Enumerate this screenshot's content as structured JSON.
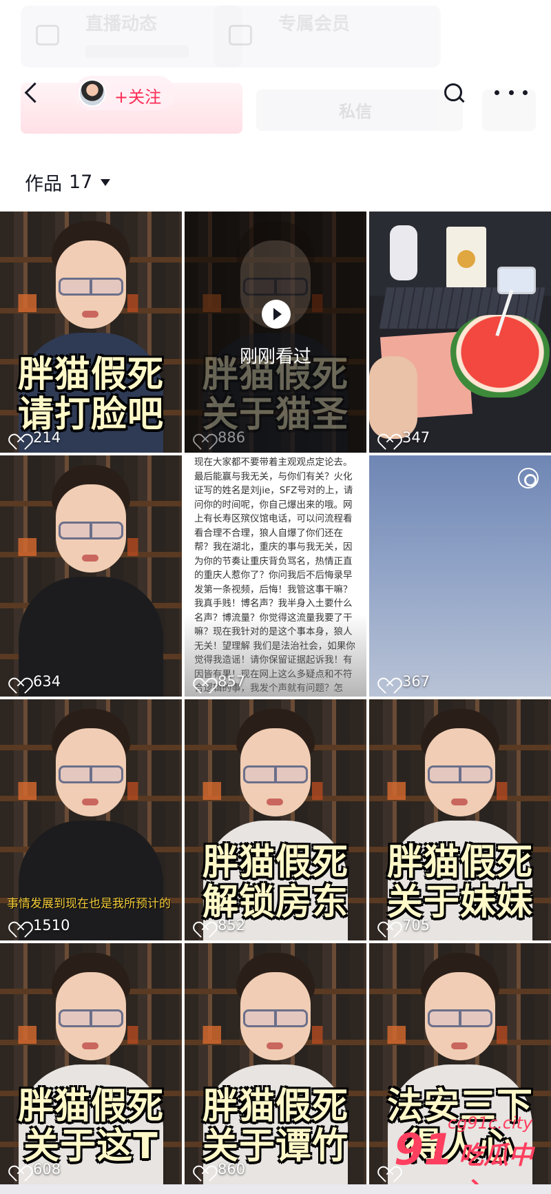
{
  "header": {
    "bg_left_title": "直播动态",
    "bg_right_title": "专属会员",
    "bg_message": "私信",
    "follow_label": "+关注"
  },
  "works": {
    "label": "作品",
    "count": "17"
  },
  "tiles": [
    {
      "caption1": "胖猫假死",
      "caption2": "请打脸吧",
      "likes": "214"
    },
    {
      "caption1": "胖猫假死",
      "caption2": "关于猫圣",
      "likes": "886",
      "watched": "刚刚看过"
    },
    {
      "likes": "347"
    },
    {
      "likes": "634"
    },
    {
      "likes": "857",
      "text": "现在大家都不要带着主观观点定论去。最后能赢与我无关，与你们有关？火化证写的姓名是刘jie，SFZ号对的上，请问你的时间呢，你自己爆出来的哦。网上有长寿区殡仪馆电话，可以问流程看看合理不合理，狼人自爆了你们还在帮？我在湖北，重庆的事与我无关，因为你的节奏让重庆背负骂名，热情正直的重庆人惹你了？你问我后不后悔录早发第一条视频，后悔！我管这事干嘛？我真手贱！博名声？我半身入土要什么名声？博流量？你觉得这流量我要了干嘛？现在我针对的是这个事本身，狼人无关！望理解 我们是法治社会，如果你觉得我造谣！请你保留证据起诉我！有因皆有果！现在网上这么多疑点和不符合逻辑的事，我发个声就有问题？怎么？我不配质疑？那你倒是打我脸啊！你就一套小作文吗？一转舆论，那这是我最后的一条小作文，如果你拿不出实际证据打脸我，我可能就错过了！"
    },
    {
      "likes": "367"
    },
    {
      "likes": "1510",
      "subline": "事情发展到现在也是我所预计的"
    },
    {
      "caption1": "胖猫假死",
      "caption2": "解锁房东",
      "likes": "852"
    },
    {
      "caption1": "胖猫假死",
      "caption2": "关于妹妹",
      "likes": "705"
    },
    {
      "caption1": "胖猫假死",
      "caption2": "关于这T",
      "likes": "608"
    },
    {
      "caption1": "胖猫假死",
      "caption2": "关于谭竹",
      "likes": "860"
    },
    {
      "caption1": "法安三下",
      "caption2": "得人心",
      "likes": ""
    }
  ],
  "watermark": {
    "num": "91",
    "url": "cg91c.city",
    "center": "吃瓜中心"
  },
  "colors": {
    "accent": "#fe2c55",
    "caption": "#fff8c8",
    "text": "#161823"
  }
}
